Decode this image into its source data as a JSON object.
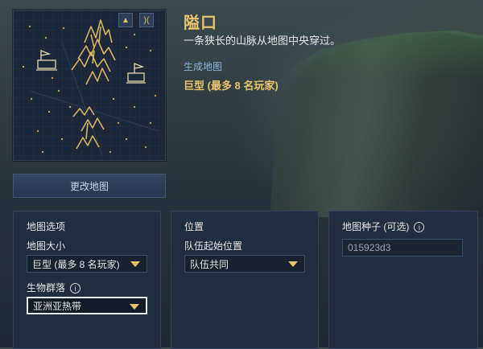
{
  "map": {
    "name": "隘口",
    "description": "一条狭长的山脉从地图中央穿过。",
    "generate_label": "生成地图",
    "generate_value": "巨型 (最多 8 名玩家)",
    "change_map_button": "更改地图"
  },
  "map_preview": {
    "btn_terrain_icon": "▲",
    "btn_symmetry_icon": ")("
  },
  "panels": {
    "map_options": {
      "header": "地图选项",
      "size_label": "地图大小",
      "size_value": "巨型 (最多 8 名玩家)",
      "biome_label": "生物群落",
      "biome_value": "亚洲亚热带"
    },
    "position": {
      "header": "位置",
      "team_start_label": "队伍起始位置",
      "team_start_value": "队伍共同"
    },
    "seed": {
      "header": "地图种子 (可选)",
      "value": "015923d3"
    }
  },
  "colors": {
    "accent_gold": "#e8c36a",
    "link_blue": "#8fb3d9",
    "panel_bg": "#212e42"
  }
}
